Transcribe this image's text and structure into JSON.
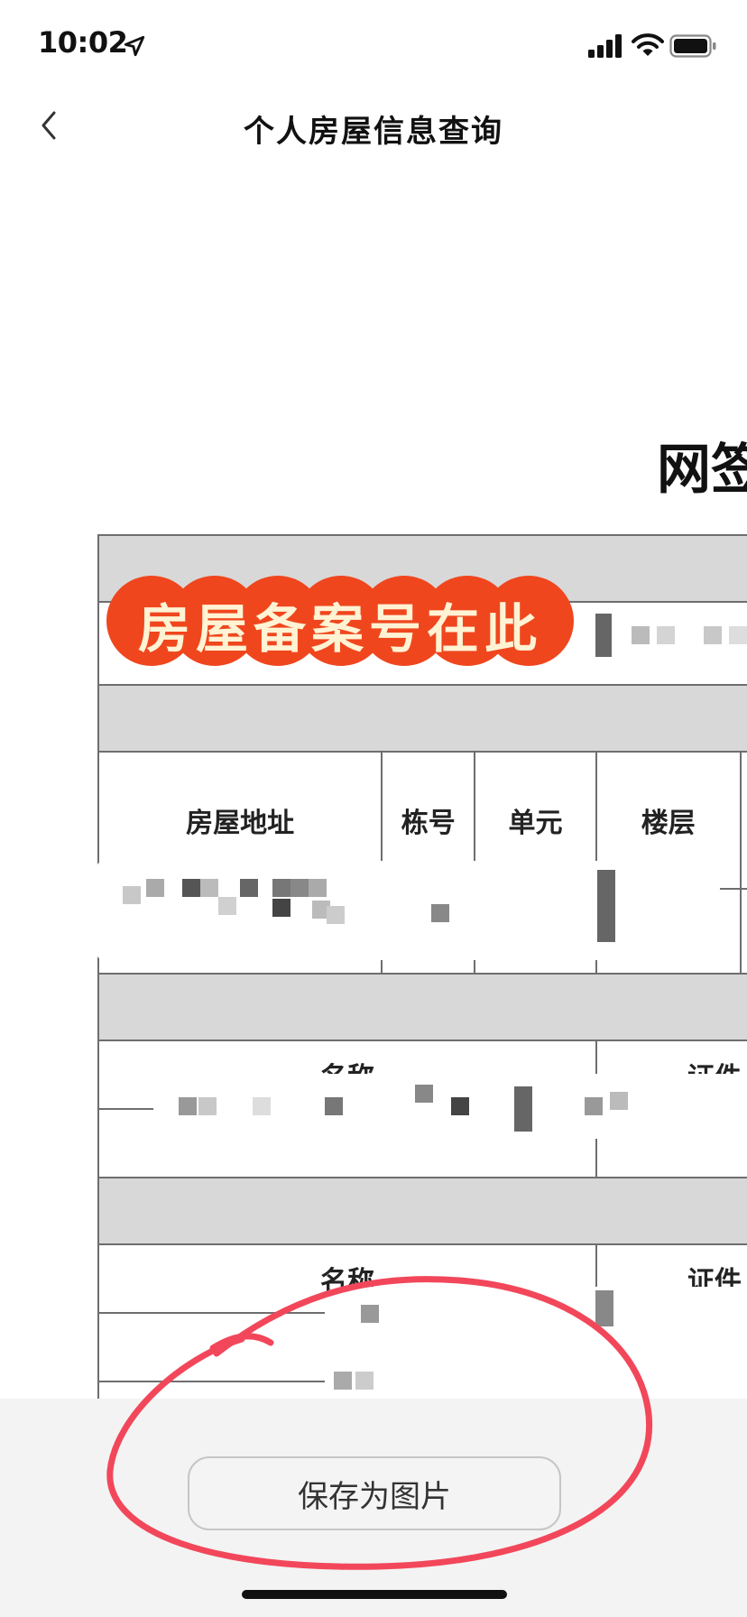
{
  "status_bar": {
    "time": "10:02"
  },
  "nav": {
    "title": "个人房屋信息查询"
  },
  "document": {
    "title_partial": "网签",
    "annotation": "房屋备案号在此",
    "house_headers": [
      "房屋地址",
      "栋号",
      "单元",
      "楼层"
    ],
    "party1_headers": [
      "名称",
      "证件"
    ],
    "party2_headers": [
      "名称",
      "证件"
    ]
  },
  "actions": {
    "save_label": "保存为图片"
  },
  "colors": {
    "annotation_bg": "#f0461e",
    "annotation_text": "#fff3d4",
    "circle": "#f2475a"
  }
}
